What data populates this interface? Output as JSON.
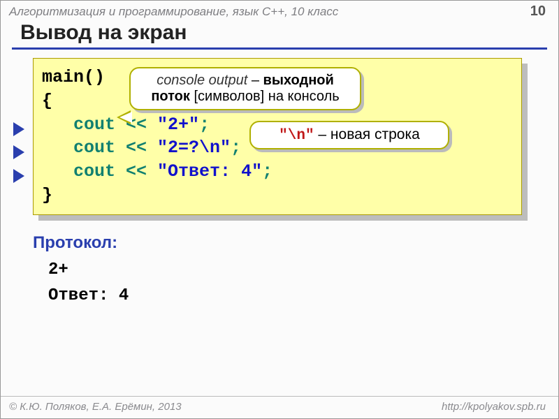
{
  "header": {
    "course": "Алгоритмизация и программирование, язык  C++, 10 класс",
    "page": "10"
  },
  "title": "Вывод на экран",
  "code": {
    "l1": "main()",
    "l2": "{",
    "l3_indent": "   ",
    "l3_cout": "cout",
    "l3_op": " << ",
    "l3_str": "\"2+\"",
    "l3_semi": ";",
    "l4_indent": "   ",
    "l4_cout": "cout",
    "l4_op": " << ",
    "l4_str": "\"2=?\\n\"",
    "l4_semi": ";",
    "l5_indent": "   ",
    "l5_cout": "cout",
    "l5_op": " << ",
    "l5_str": "\"Ответ: 4\"",
    "l5_semi": ";",
    "l6": "}"
  },
  "callout1": {
    "a": "console output",
    "b": " – ",
    "c": "выходной поток",
    "d": " [символов] на консоль"
  },
  "callout2": {
    "a": "\"\\n\"",
    "b": " – новая строка"
  },
  "protocol": {
    "title": "Протокол:",
    "line1": "2+",
    "line2": "Ответ: 4"
  },
  "footer": {
    "left": "© К.Ю. Поляков, Е.А. Ерёмин, 2013",
    "right": "http://kpolyakov.spb.ru"
  }
}
